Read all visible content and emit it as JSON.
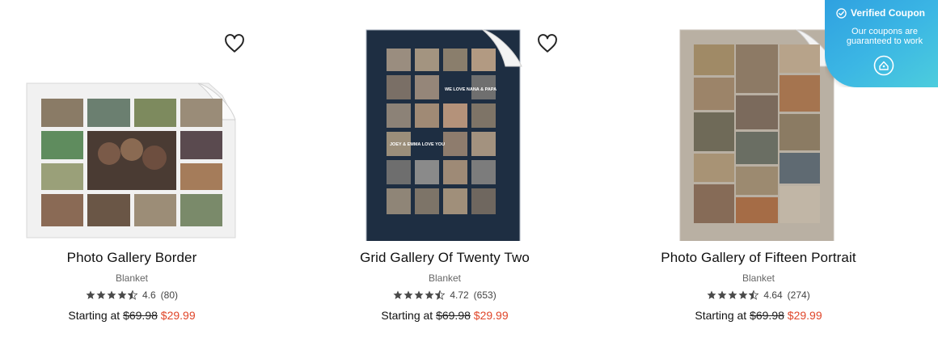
{
  "products": [
    {
      "title": "Photo Gallery Border",
      "subtitle": "Blanket",
      "rating": "4.6",
      "rating_value": 4.6,
      "reviews": "(80)",
      "price_prefix": "Starting at",
      "original_price": "$69.98",
      "sale_price": "$29.99",
      "icon": "heart-outline-icon"
    },
    {
      "title": "Grid Gallery Of Twenty Two",
      "subtitle": "Blanket",
      "rating": "4.72",
      "rating_value": 4.72,
      "reviews": "(653)",
      "price_prefix": "Starting at",
      "original_price": "$69.98",
      "sale_price": "$29.99",
      "icon": "heart-outline-icon",
      "image_text_1": "WE LOVE NANA & PAPA",
      "image_text_2": "JOEY & EMMA LOVE YOU"
    },
    {
      "title": "Photo Gallery of Fifteen Portrait",
      "subtitle": "Blanket",
      "rating": "4.64",
      "rating_value": 4.64,
      "reviews": "(274)",
      "price_prefix": "Starting at",
      "original_price": "$69.98",
      "sale_price": "$29.99",
      "icon": "heart-outline-icon"
    }
  ],
  "coupon": {
    "title": "Verified Coupon",
    "message": "Our coupons are guaranteed to work",
    "icons": [
      "check-circle-icon",
      "coupon-logo-icon"
    ]
  },
  "colors": {
    "sale_price": "#e0462a",
    "star": "#4a4a4a",
    "coupon_gradient_start": "#2e9fe0",
    "coupon_gradient_end": "#4fd0dc"
  }
}
